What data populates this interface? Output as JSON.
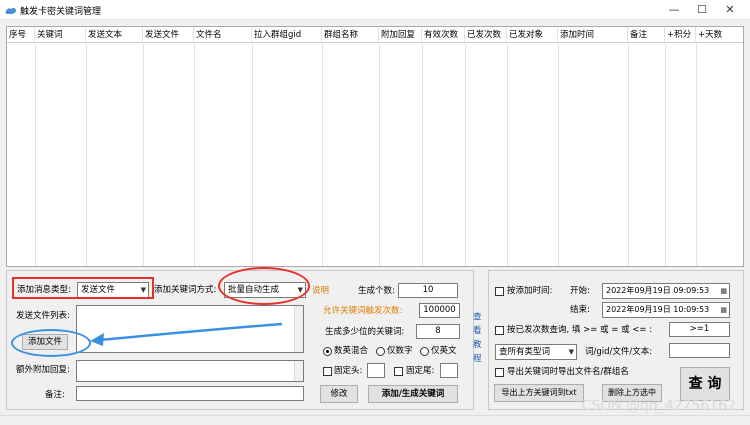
{
  "window": {
    "title": "触发卡密关键词管理",
    "min": "—",
    "max": "☐",
    "close": "✕"
  },
  "grid": {
    "columns": [
      "序号",
      "关键词",
      "发送文本",
      "发送文件",
      "文件名",
      "拉入群组gid",
      "群组名称",
      "附加回复",
      "有效次数",
      "已发次数",
      "已发对象",
      "添加时间",
      "备注",
      "+积分",
      "+天数"
    ]
  },
  "left": {
    "msg_type_label": "添加消息类型:",
    "msg_type_value": "发送文件",
    "add_mode_label": "添加关键词方式:",
    "add_mode_value": "批量自动生成",
    "explain_link": "说明",
    "file_list_label": "发送文件列表:",
    "add_file_button": "添加文件",
    "extra_reply_label": "额外附加回复:",
    "note_label": "备注:",
    "gen_count_label": "生成个数:",
    "gen_count_value": "10",
    "trigger_count_label": "允许关键词触发次数:",
    "trigger_count_value": "100000",
    "digits_label": "生成多少位的关键词:",
    "digits_value": "8",
    "radio_mixed": "数英混合",
    "radio_digits": "仅数字",
    "radio_letters": "仅英文",
    "fixed_head": "固定头:",
    "fixed_tail": "固定尾:",
    "edit_button": "修改",
    "add_generate_button": "添加/生成关键词",
    "tutorial_link": "查看教程"
  },
  "right": {
    "by_add_time_label": "按添加时间:",
    "start_label": "开始:",
    "start_value": "2022年09月19日  09:09:53",
    "end_label": "结束:",
    "end_value": "2022年09月19日  10:09:53",
    "by_sent_label": "按已发次数查询, 填 >= 或 = 或 <= :",
    "sent_value": ">=1",
    "type_filter_value": "查所有类型词",
    "word_gid_label": "词/gid/文件/文本:",
    "export_check_label": "导出关键词时导出文件名/群组名",
    "export_button": "导出上方关键词到txt",
    "delete_button": "删除上方选中",
    "query_button": "查 询"
  },
  "watermark": "CSDN @qq_42756162",
  "colors": {
    "annotation_red": "#e8302a",
    "annotation_blue": "#3a8fe0",
    "link_orange": "#e07b00",
    "link_blue": "#1a5fb4"
  }
}
